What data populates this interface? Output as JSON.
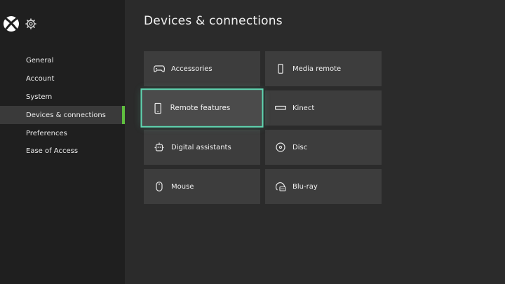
{
  "page": {
    "title": "Devices & connections"
  },
  "sidebar": {
    "items": [
      {
        "label": "General"
      },
      {
        "label": "Account"
      },
      {
        "label": "System"
      },
      {
        "label": "Devices & connections",
        "selected": true
      },
      {
        "label": "Preferences"
      },
      {
        "label": "Ease of Access"
      }
    ]
  },
  "tiles": [
    {
      "label": "Accessories",
      "icon": "gamepad-icon"
    },
    {
      "label": "Media remote",
      "icon": "remote-icon"
    },
    {
      "label": "Remote features",
      "icon": "phone-icon",
      "focused": true
    },
    {
      "label": "Kinect",
      "icon": "kinect-icon"
    },
    {
      "label": "Digital assistants",
      "icon": "assistant-icon"
    },
    {
      "label": "Disc",
      "icon": "disc-icon"
    },
    {
      "label": "Mouse",
      "icon": "mouse-icon"
    },
    {
      "label": "Blu-ray",
      "icon": "bluray-icon"
    }
  ],
  "colors": {
    "accent": "#5fbf3f",
    "focus": "#5fd6b1",
    "background": "#2b2b2b",
    "sidebar": "#1f1f1f",
    "tile": "#3d3d3d"
  }
}
